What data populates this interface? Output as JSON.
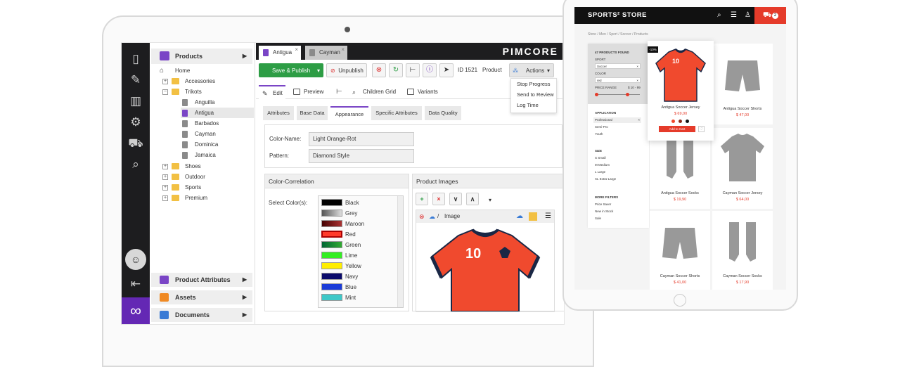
{
  "pimcore": {
    "brand": "PIMCORE",
    "tree": {
      "header": "Products",
      "items": [
        {
          "label": "Home",
          "type": "home"
        },
        {
          "label": "Accessories",
          "type": "folder"
        },
        {
          "label": "Trikots",
          "type": "folder"
        },
        {
          "label": "Anguilla",
          "type": "doc"
        },
        {
          "label": "Antigua",
          "type": "doc",
          "selected": true
        },
        {
          "label": "Barbados",
          "type": "doc"
        },
        {
          "label": "Cayman",
          "type": "doc"
        },
        {
          "label": "Dominica",
          "type": "doc"
        },
        {
          "label": "Jamaica",
          "type": "doc"
        },
        {
          "label": "Shoes",
          "type": "folder"
        },
        {
          "label": "Outdoor",
          "type": "folder"
        },
        {
          "label": "Sports",
          "type": "folder"
        },
        {
          "label": "Premium",
          "type": "folder"
        }
      ],
      "bottom": [
        "Product Attributes",
        "Assets",
        "Documents"
      ]
    },
    "open_tabs": [
      "Antigua",
      "Cayman"
    ],
    "toolbar": {
      "save": "Save & Publish",
      "unpublish": "Unpublish",
      "id": "ID 1521",
      "type": "Product",
      "actions": "Actions"
    },
    "actions_menu": [
      "Stop Progress",
      "Send to Review",
      "Log Time"
    ],
    "subtabs": [
      "Edit",
      "Preview",
      "Children Grid",
      "Variants"
    ],
    "layout_tabs": [
      "Attributes",
      "Base Data",
      "Appearance",
      "Specific Attributes",
      "Data Quality"
    ],
    "fields": {
      "color_name_label": "Color-Name:",
      "color_name_value": "Light Orange-Rot",
      "pattern_label": "Pattern:",
      "pattern_value": "Diamond Style"
    },
    "color_correlation": {
      "title": "Color-Correlation",
      "label": "Select Color(s):",
      "colors": [
        {
          "name": "Black",
          "hex": "#000000"
        },
        {
          "name": "Grey",
          "hex": "#808080"
        },
        {
          "name": "Maroon",
          "hex": "#800000"
        },
        {
          "name": "Red",
          "hex": "#ff0000"
        },
        {
          "name": "Green",
          "hex": "#008000"
        },
        {
          "name": "Lime",
          "hex": "#00ff00"
        },
        {
          "name": "Yellow",
          "hex": "#ffff00"
        },
        {
          "name": "Navy",
          "hex": "#000080"
        },
        {
          "name": "Blue",
          "hex": "#0000ff"
        },
        {
          "name": "Mint",
          "hex": "#3ec8c8"
        }
      ]
    },
    "product_images": {
      "title": "Product Images",
      "image_label": "Image",
      "jersey_number": "10"
    }
  },
  "store": {
    "name": "SPORTS² STORE",
    "cart_count": "2",
    "breadcrumb": "Store  /  Men  /  Sport  /  Soccer  /  Products",
    "filters": {
      "found": "47 PRODUCTS FOUND",
      "sport_label": "SPORT",
      "sport_value": "Soccer",
      "color_label": "COLOR",
      "color_value": "red",
      "price_label": "PRICE RANGE",
      "price_value": "$ 10 - 99",
      "application_label": "APPLICATION",
      "application_options": [
        "Professional",
        "Semi-Pro",
        "Youth"
      ],
      "size_label": "SIZE",
      "sizes": [
        "S    Small",
        "M    Medium",
        "L    Large",
        "XL   Extra-Large"
      ],
      "more_label": "MORE FILTERS",
      "more_options": [
        "Price Saver",
        "New in Stock",
        "Sale"
      ]
    },
    "featured": {
      "badge": "-10%",
      "name": "Antigua Soccer Jersey",
      "price": "$ 69,00",
      "button": "Add to Cart",
      "number": "10"
    },
    "products": [
      {
        "name": "Antigua Soccer Shorts",
        "price": "$ 47,00"
      },
      {
        "name": "Antigua Soccer Socks",
        "price": "$ 19,90"
      },
      {
        "name": "Cayman Soccer Jersey",
        "price": "$ 64,00"
      },
      {
        "name": "Cayman Soccer Shorts",
        "price": "$ 41,00"
      },
      {
        "name": "Cayman Soccer Socks",
        "price": "$ 17,90"
      }
    ],
    "colors": {
      "accent": "#e53b2a",
      "header": "#111111"
    }
  },
  "colors": {
    "pimcore_purple": "#6428b4",
    "save_green": "#2d9d45"
  }
}
